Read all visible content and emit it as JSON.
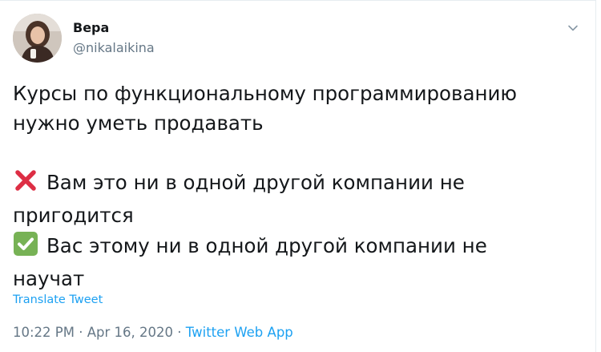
{
  "author": {
    "name": "Вера",
    "handle": "@nikalaikina"
  },
  "tweet": {
    "line1": "Курсы по функциональному программированию",
    "line2": "нужно уметь продавать",
    "cross_text": "Вам это ни в одной другой компании не",
    "cross_text_cont": "пригодится",
    "check_text": "Вас этому ни в одной другой компании не",
    "check_text_cont": "научат"
  },
  "icons": {
    "cross": "cross-mark-emoji",
    "check": "check-mark-button-emoji",
    "caret": "chevron-down-icon"
  },
  "translate_label": "Translate Tweet",
  "meta": {
    "time": "10:22 PM",
    "sep1": " · ",
    "date": "Apr 16, 2020",
    "sep2": " · ",
    "source": "Twitter Web App"
  },
  "colors": {
    "link_blue": "#1da1f2",
    "secondary_gray": "#657786",
    "text_dark": "#14171a",
    "cross_red": "#dd2e44",
    "check_green": "#77b255"
  }
}
